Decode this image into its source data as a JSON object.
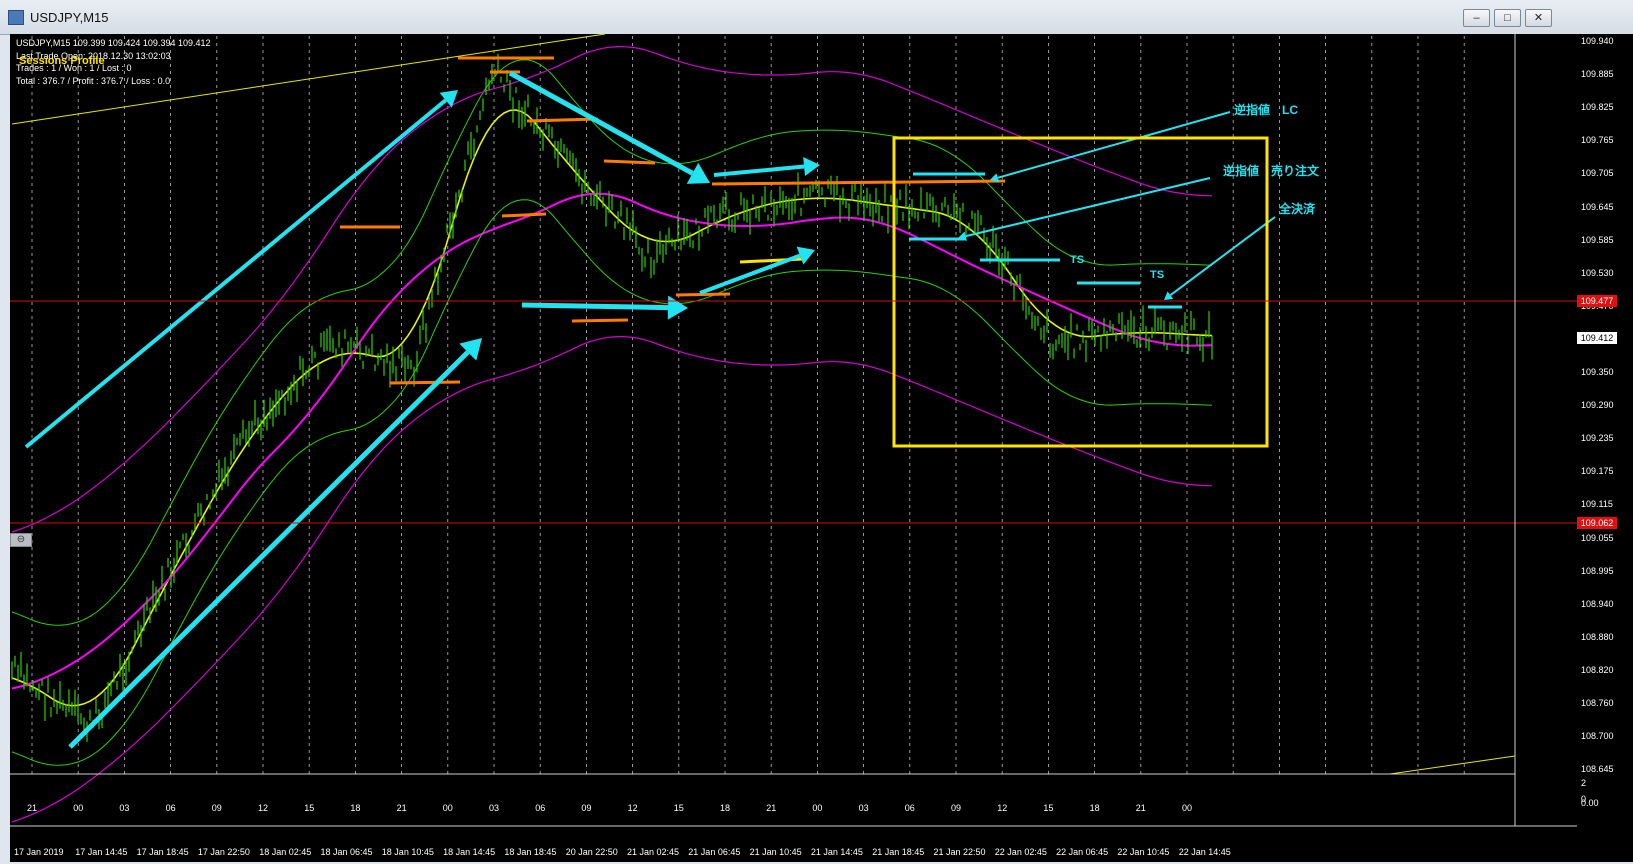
{
  "window": {
    "title": "USDJPY,M15",
    "buttons": [
      "–",
      "□",
      "✕"
    ]
  },
  "info": {
    "header": "USDJPY,M15  109.399 109.424 109.394 109.412",
    "line2": "Last Trade Open: 2018.12.30 13:02:03",
    "line3": "Trades : 1 / Won : 1 / Lost : 0",
    "line4": "Total : 376.7 / Profit : 376.7 / Loss : 0.0",
    "sessions": "Sessions Profile"
  },
  "price_scale": [
    "109.940",
    "109.885",
    "109.825",
    "109.765",
    "109.705",
    "109.645",
    "109.585",
    "109.530",
    "109.470",
    "109.412",
    "109.350",
    "109.290",
    "109.235",
    "109.175",
    "109.115",
    "109.055",
    "108.995",
    "108.940",
    "108.880",
    "108.820",
    "108.760",
    "108.700",
    "108.645"
  ],
  "badges": {
    "upper_line": "109.477",
    "current": "109.412",
    "lower_line": "109.062"
  },
  "indicator_scale": [
    "2",
    "0",
    "0.00"
  ],
  "time_axis": [
    "21",
    "00",
    "03",
    "06",
    "09",
    "12",
    "15",
    "18",
    "21",
    "00",
    "03",
    "06",
    "09",
    "12",
    "15",
    "18",
    "21",
    "00",
    "03",
    "06",
    "09",
    "12",
    "15",
    "18",
    "21",
    "00"
  ],
  "date_axis": [
    "17 Jan 2019",
    "17 Jan 14:45",
    "17 Jan 18:45",
    "17 Jan 22:50",
    "18 Jan 02:45",
    "18 Jan 06:45",
    "18 Jan 10:45",
    "18 Jan 14:45",
    "18 Jan 18:45",
    "20 Jan 22:50",
    "21 Jan 02:45",
    "21 Jan 06:45",
    "21 Jan 10:45",
    "21 Jan 14:45",
    "21 Jan 18:45",
    "21 Jan 22:50",
    "22 Jan 02:45",
    "22 Jan 06:45",
    "22 Jan 10:45",
    "22 Jan 14:45"
  ],
  "annotations": {
    "lc": "逆指値　LC",
    "sell": "逆指値　売り注文",
    "close": "全決済",
    "ts1": "TS",
    "ts2": "TS"
  },
  "chart_data": {
    "type": "line",
    "symbol": "USDJPY",
    "timeframe": "M15",
    "ylim": [
      108.645,
      109.94
    ],
    "x": [
      "17 Jan 21:00",
      "18 Jan 00:00",
      "18 Jan 06:00",
      "18 Jan 12:00",
      "18 Jan 18:00",
      "19 Jan 00:00",
      "19 Jan 03:00",
      "19 Jan 06:00",
      "21 Jan 12:00",
      "21 Jan 18:00",
      "22 Jan 00:00",
      "22 Jan 06:00",
      "22 Jan 09:00",
      "22 Jan 12:00",
      "22 Jan 18:00",
      "23 Jan 00:00"
    ],
    "series": [
      {
        "values": [
          108.82,
          108.72,
          109.0,
          109.25,
          109.4,
          109.35,
          109.88,
          109.7,
          109.55,
          109.63,
          109.66,
          109.64,
          109.62,
          109.4,
          109.42,
          109.41
        ]
      }
    ],
    "hlines": [
      109.477,
      109.062
    ],
    "colors": {
      "candles": "#2bd100",
      "ma_fast": "#e8f400",
      "ma_slow": "#ff00ff",
      "bands_inner": "#2bd100",
      "bands_outer": "#d400d4",
      "arrows": "#23e3f0",
      "levels": "#ff7c00",
      "box": "#ffe400",
      "hline": "#ff2020"
    }
  }
}
